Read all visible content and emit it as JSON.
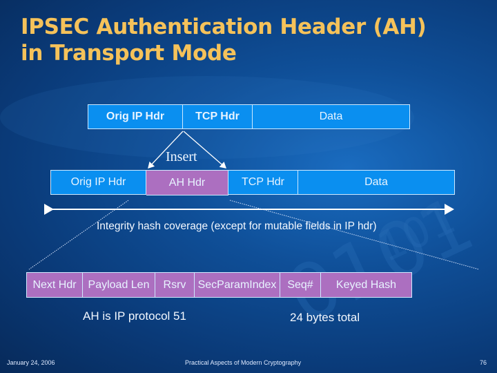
{
  "slide": {
    "title_line1": "IPSEC Authentication Header (AH)",
    "title_line2": "in Transport Mode",
    "original_packet": [
      "Orig IP Hdr",
      "TCP Hdr",
      "Data"
    ],
    "insert_label": "Insert",
    "ah_packet": [
      "Orig IP Hdr",
      "AH Hdr",
      "TCP Hdr",
      "Data"
    ],
    "coverage_label": "Integrity hash coverage (except for mutable fields in IP hdr)",
    "ah_fields": [
      "Next Hdr",
      "Payload Len",
      "Rsrv",
      "SecParamIndex",
      "Seq#",
      "Keyed Hash"
    ],
    "note_protocol": "AH is IP protocol 51",
    "note_size": "24 bytes total"
  },
  "footer": {
    "date": "January 24, 2006",
    "course": "Practical Aspects of Modern Cryptography",
    "page": "76"
  },
  "colors": {
    "title": "#f5c25a",
    "packet_blue": "#0a8ff0",
    "ah_purple": "#ac6fc0"
  }
}
